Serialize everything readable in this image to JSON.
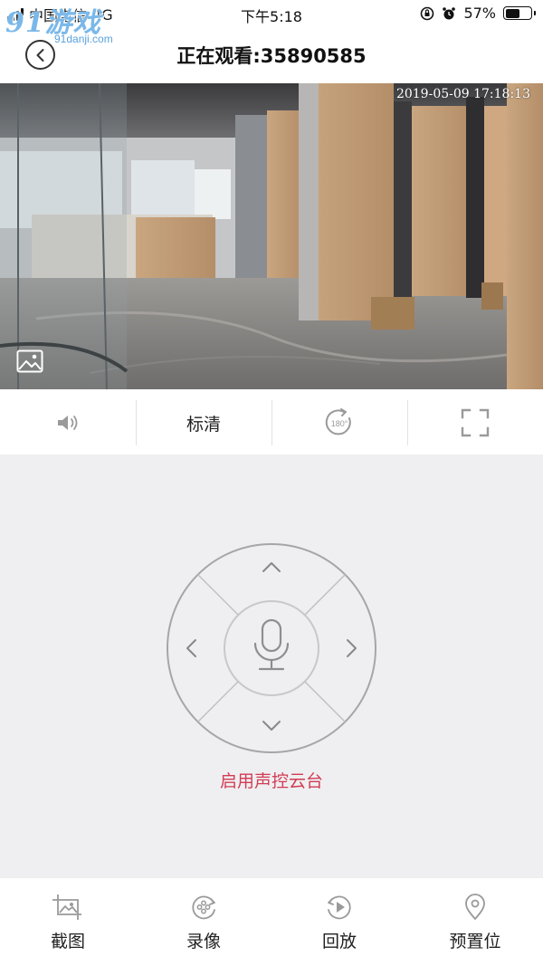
{
  "status": {
    "carrier": "中国电信",
    "network": "4G",
    "time": "下午5:18",
    "battery_percent": "57%",
    "battery_level": 0.57
  },
  "watermark": {
    "brand": "91游戏",
    "domain": "91danji.com"
  },
  "header": {
    "title": "正在观看:35890585"
  },
  "video": {
    "timestamp": "2019-05-09  17:18:13"
  },
  "controls": {
    "quality_label": "标清",
    "rotate_label": "180°"
  },
  "ptz": {
    "voice_label": "启用声控云台"
  },
  "toolbar": {
    "screenshot": "截图",
    "record": "录像",
    "playback": "回放",
    "preset": "预置位"
  },
  "colors": {
    "accent": "#d23c55",
    "panel_bg": "#efeff1",
    "icon_gray": "#9a9a9a"
  },
  "icons": [
    "back-icon",
    "image-icon",
    "volume-icon",
    "rotate-180-icon",
    "fullscreen-icon",
    "microphone-icon",
    "screenshot-icon",
    "record-icon",
    "playback-icon",
    "preset-location-icon"
  ]
}
